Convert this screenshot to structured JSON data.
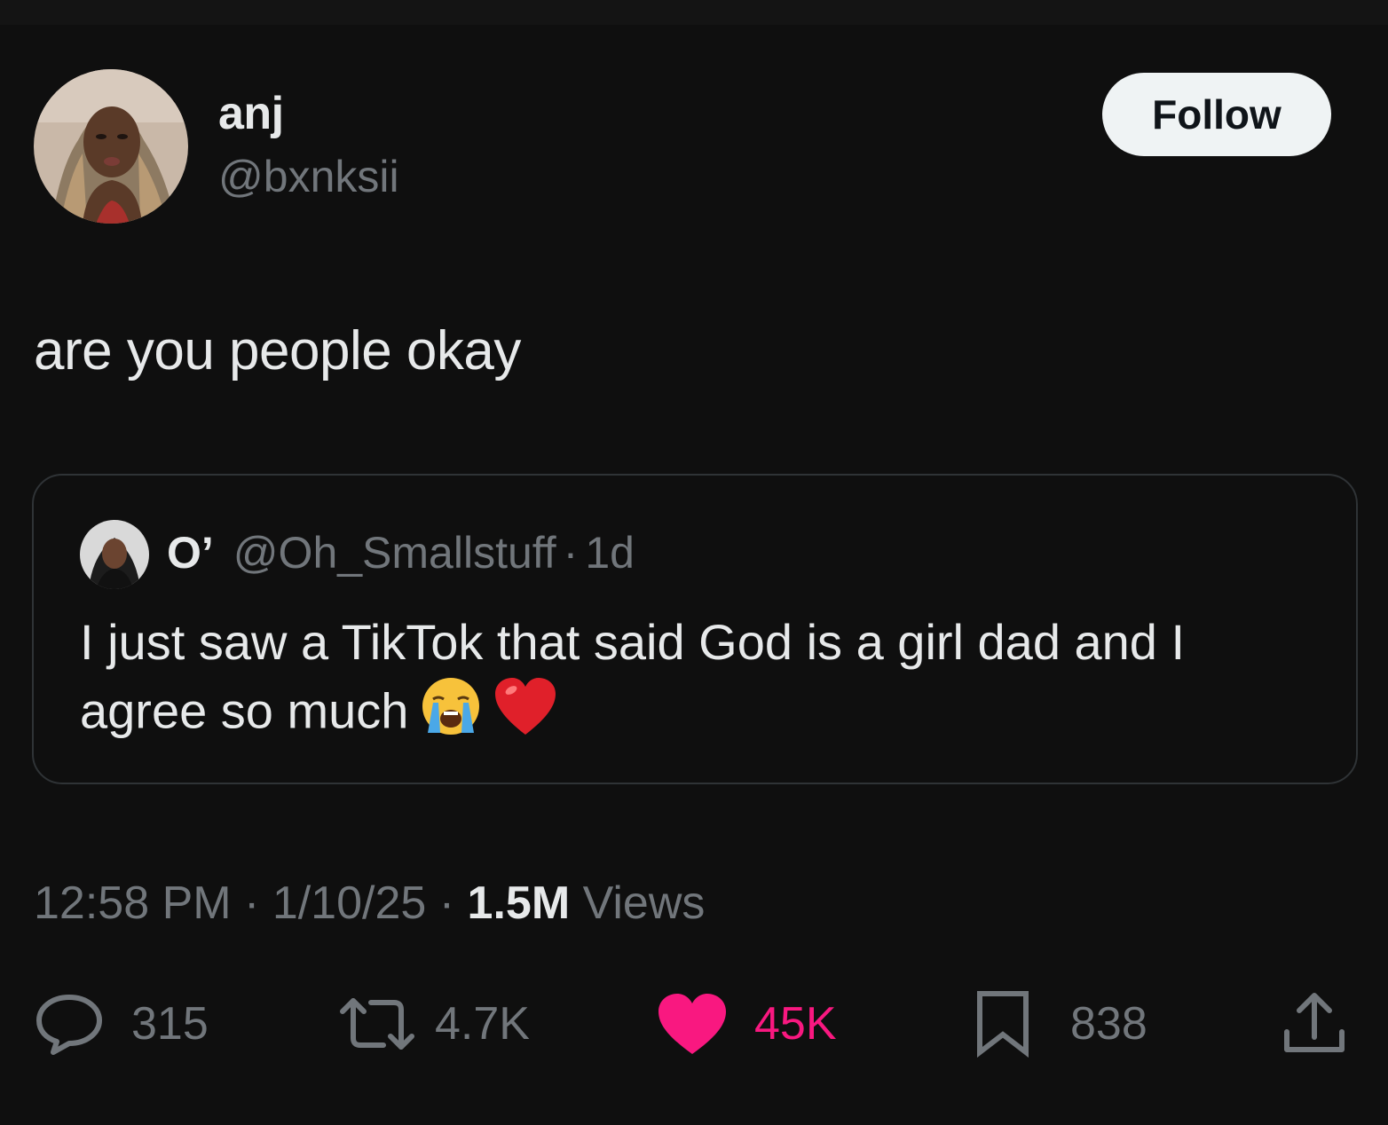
{
  "author": {
    "display_name": "anj",
    "handle": "@bxnksii"
  },
  "follow_button": {
    "label": "Follow"
  },
  "tweet": {
    "text": "are you people okay"
  },
  "quoted_tweet": {
    "display_name": "O’",
    "handle": "@Oh_Smallstuff",
    "separator": "·",
    "time": "1d",
    "text": "I just saw a TikTok that said God is a girl dad and I agree so much",
    "emojis": [
      "loudly-crying-face",
      "red-heart"
    ]
  },
  "meta": {
    "time": "12:58 PM",
    "sep1": "·",
    "date": "1/10/25",
    "sep2": "·",
    "views_count": "1.5M",
    "views_label": "Views"
  },
  "actions": {
    "replies": "315",
    "reposts": "4.7K",
    "likes": "45K",
    "bookmarks": "838"
  },
  "colors": {
    "background": "#0f0f0f",
    "text_primary": "#e7e9ea",
    "text_secondary": "#71767b",
    "like_pink": "#f91880",
    "border": "#2f3336"
  }
}
